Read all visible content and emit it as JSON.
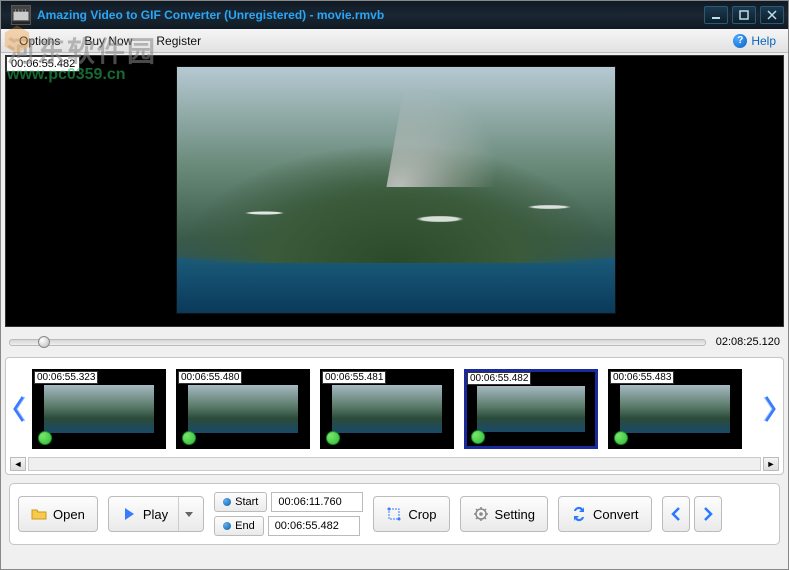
{
  "titlebar": {
    "title": "Amazing Video to GIF Converter (Unregistered) - movie.rmvb"
  },
  "menu": {
    "options": "Options",
    "buy_now": "Buy Now",
    "register": "Register",
    "help": "Help"
  },
  "watermark": {
    "cn": "河东软件园",
    "url": "www.pc0359.cn"
  },
  "preview": {
    "timecode": "00:06:55.482"
  },
  "seek": {
    "duration": "02:08:25.120"
  },
  "thumbs": [
    {
      "ts": "00:06:55.323",
      "selected": false
    },
    {
      "ts": "00:06:55.480",
      "selected": false
    },
    {
      "ts": "00:06:55.481",
      "selected": false
    },
    {
      "ts": "00:06:55.482",
      "selected": true
    },
    {
      "ts": "00:06:55.483",
      "selected": false
    }
  ],
  "toolbar": {
    "open": "Open",
    "play": "Play",
    "start": "Start",
    "end": "End",
    "start_time": "00:06:11.760",
    "end_time": "00:06:55.482",
    "crop": "Crop",
    "setting": "Setting",
    "convert": "Convert"
  }
}
